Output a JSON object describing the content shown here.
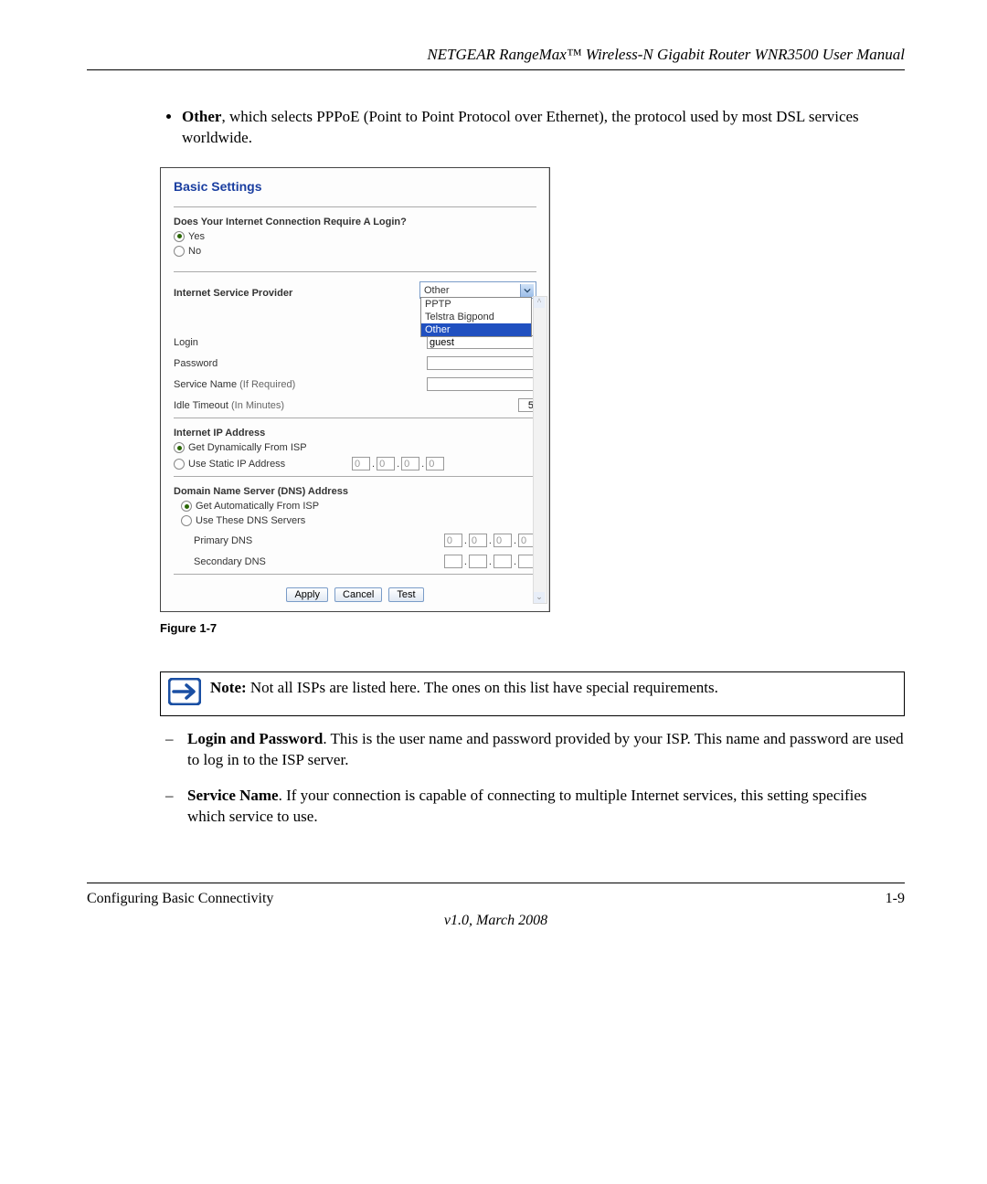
{
  "header": {
    "title": "NETGEAR RangeMax™ Wireless-N Gigabit Router WNR3500 User Manual"
  },
  "bullet": {
    "bold": "Other",
    "rest": ", which selects PPPoE (Point to Point Protocol over Ethernet), the protocol used by most DSL services worldwide."
  },
  "figure": {
    "title": "Basic Settings",
    "q_login": "Does Your Internet Connection Require A Login?",
    "yes": "Yes",
    "no": "No",
    "isp_label": "Internet Service Provider",
    "isp_value": "Other",
    "isp_options": {
      "a": "PPTP",
      "b": "Telstra Bigpond",
      "c": "Other"
    },
    "login_label": "Login",
    "login_value": "guest",
    "password_label": "Password",
    "service_label": "Service Name",
    "service_hint": "(If Required)",
    "idle_label": "Idle Timeout",
    "idle_hint": "(In Minutes)",
    "idle_value": "5",
    "ip_head": "Internet IP Address",
    "ip_dyn": "Get Dynamically From ISP",
    "ip_static": "Use Static IP Address",
    "zero": "0",
    "dns_head": "Domain Name Server (DNS) Address",
    "dns_auto": "Get Automatically From ISP",
    "dns_manual": "Use These DNS Servers",
    "dns_primary": "Primary DNS",
    "dns_secondary": "Secondary DNS",
    "btn_apply": "Apply",
    "btn_cancel": "Cancel",
    "btn_test": "Test",
    "caption": "Figure 1-7"
  },
  "note": {
    "bold": "Note:",
    "text": " Not all ISPs are listed here. The ones on this list have special requirements."
  },
  "items": {
    "a_bold": "Login and Password",
    "a_rest": ". This is the user name and password provided by your ISP. This name and password are used to log in to the ISP server.",
    "b_bold": "Service Name",
    "b_rest": ". If your connection is capable of connecting to multiple Internet services, this setting specifies which service to use."
  },
  "footer": {
    "left": "Configuring Basic Connectivity",
    "right": "1-9",
    "center": "v1.0, March 2008"
  }
}
